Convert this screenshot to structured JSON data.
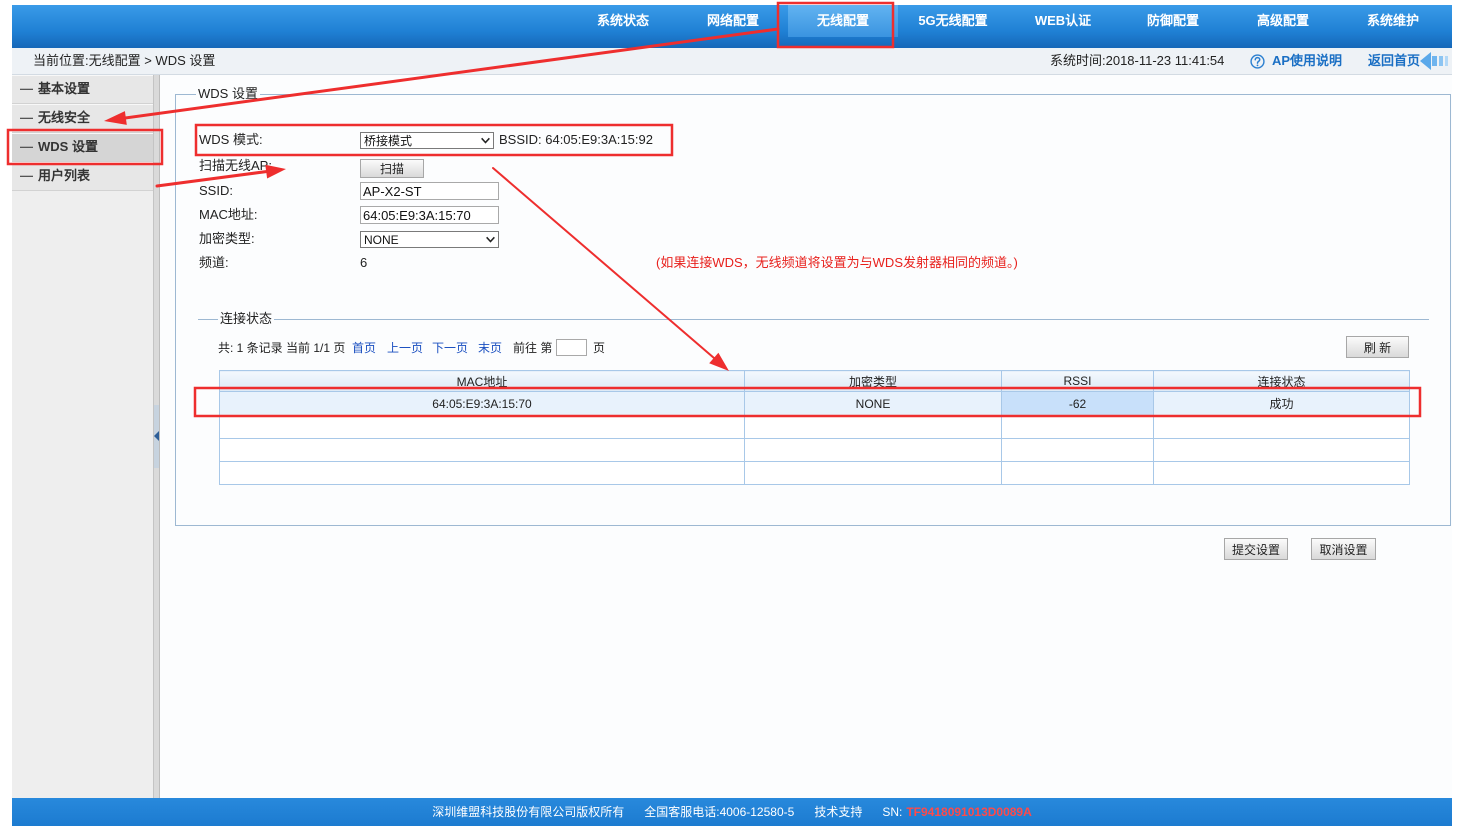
{
  "colors": {
    "nav_blue": "#1f80d4",
    "footer_blue": "#1c7bd0",
    "header_link_blue": "#1a6fc4",
    "link_blue": "#1a4fc0",
    "note_red": "#e8211d",
    "sn_red": "#ff4a4a",
    "annotation_red": "#ee2e2e",
    "table_border": "#a8c8e8",
    "row_highlight": "#e8f2fc",
    "cell_highlight": "#c8e0fa"
  },
  "nav": {
    "items": [
      {
        "label": "系统状态",
        "active": false
      },
      {
        "label": "网络配置",
        "active": false
      },
      {
        "label": "无线配置",
        "active": true
      },
      {
        "label": "5G无线配置",
        "active": false
      },
      {
        "label": "WEB认证",
        "active": false
      },
      {
        "label": "防御配置",
        "active": false
      },
      {
        "label": "高级配置",
        "active": false
      },
      {
        "label": "系统维护",
        "active": false
      }
    ]
  },
  "breadcrumb": "当前位置:无线配置 > WDS 设置",
  "header": {
    "system_time": "系统时间:2018-11-23 11:41:54",
    "help_icon": "question-circle-icon",
    "help_label": "AP使用说明",
    "home_label": "返回首页",
    "home_icon": "back-arrow-icon"
  },
  "sidebar": {
    "items": [
      {
        "prefix": "—",
        "label": "基本设置",
        "active": false
      },
      {
        "prefix": "—",
        "label": "无线安全",
        "active": false
      },
      {
        "prefix": "—",
        "label": "WDS 设置",
        "active": true
      },
      {
        "prefix": "—",
        "label": "用户列表",
        "active": false
      }
    ],
    "collapse_icon": "collapse-left-icon"
  },
  "wds": {
    "legend": "WDS 设置",
    "mode": {
      "label": "WDS 模式:",
      "value": "桥接模式",
      "bssid": "BSSID: 64:05:E9:3A:15:92"
    },
    "scan": {
      "label": "扫描无线AP:",
      "button": "扫描"
    },
    "ssid": {
      "label": "SSID:",
      "value": "AP-X2-ST"
    },
    "mac": {
      "label": "MAC地址:",
      "value": "64:05:E9:3A:15:70"
    },
    "encryption": {
      "label": "加密类型:",
      "value": "NONE"
    },
    "channel": {
      "label": "频道:",
      "value": "6"
    },
    "note": "(如果连接WDS，无线频道将设置为与WDS发射器相同的频道。)"
  },
  "status": {
    "legend": "连接状态",
    "pagination": {
      "summary": "共: 1 条记录 当前 1/1 页",
      "first": "首页",
      "prev": "上一页",
      "next": "下一页",
      "last": "末页",
      "goto_prefix": "前往 第",
      "goto_suffix": "页"
    },
    "refresh": "刷 新",
    "columns": [
      "MAC地址",
      "加密类型",
      "RSSI",
      "连接状态"
    ],
    "rows": [
      [
        "64:05:E9:3A:15:70",
        "NONE",
        "-62",
        "成功"
      ],
      [
        "",
        "",
        "",
        ""
      ],
      [
        "",
        "",
        "",
        ""
      ],
      [
        "",
        "",
        "",
        ""
      ]
    ]
  },
  "actions": {
    "submit": "提交设置",
    "cancel": "取消设置"
  },
  "footer": {
    "copyright": "深圳维盟科技股份有限公司版权所有",
    "hotline": "全国客服电话:4006-12580-5",
    "support": "技术支持",
    "sn_label": "SN:",
    "sn_value": "TF9418091013D0089A"
  }
}
